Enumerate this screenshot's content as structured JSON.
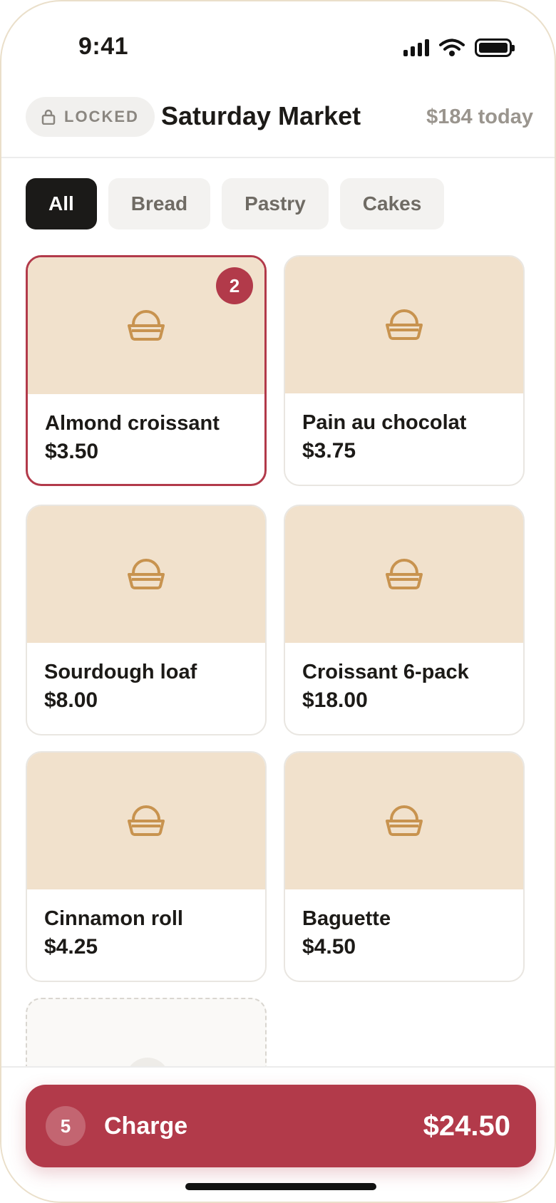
{
  "status_bar": {
    "time": "9:41"
  },
  "header": {
    "lock_label": "LOCKED",
    "title": "Saturday Market",
    "today_total": "$184 today"
  },
  "filters": [
    {
      "label": "All",
      "active": true
    },
    {
      "label": "Bread",
      "active": false
    },
    {
      "label": "Pastry",
      "active": false
    },
    {
      "label": "Cakes",
      "active": false
    }
  ],
  "products": [
    {
      "name": "Almond croissant",
      "price": "$3.50",
      "qty": "2",
      "selected": true
    },
    {
      "name": "Pain au chocolat",
      "price": "$3.75"
    },
    {
      "name": "Sourdough loaf",
      "price": "$8.00"
    },
    {
      "name": "Croissant 6-pack",
      "price": "$18.00"
    },
    {
      "name": "Cinnamon roll",
      "price": "$4.25"
    },
    {
      "name": "Baguette",
      "price": "$4.50"
    }
  ],
  "charge": {
    "count": "5",
    "label": "Charge",
    "amount": "$24.50"
  },
  "icons": {
    "lock": "lock-icon",
    "product": "bread-basket-icon"
  },
  "colors": {
    "accent": "#b23a4a",
    "thumb_bg": "#f1e1cc",
    "icon": "#c8934f"
  }
}
